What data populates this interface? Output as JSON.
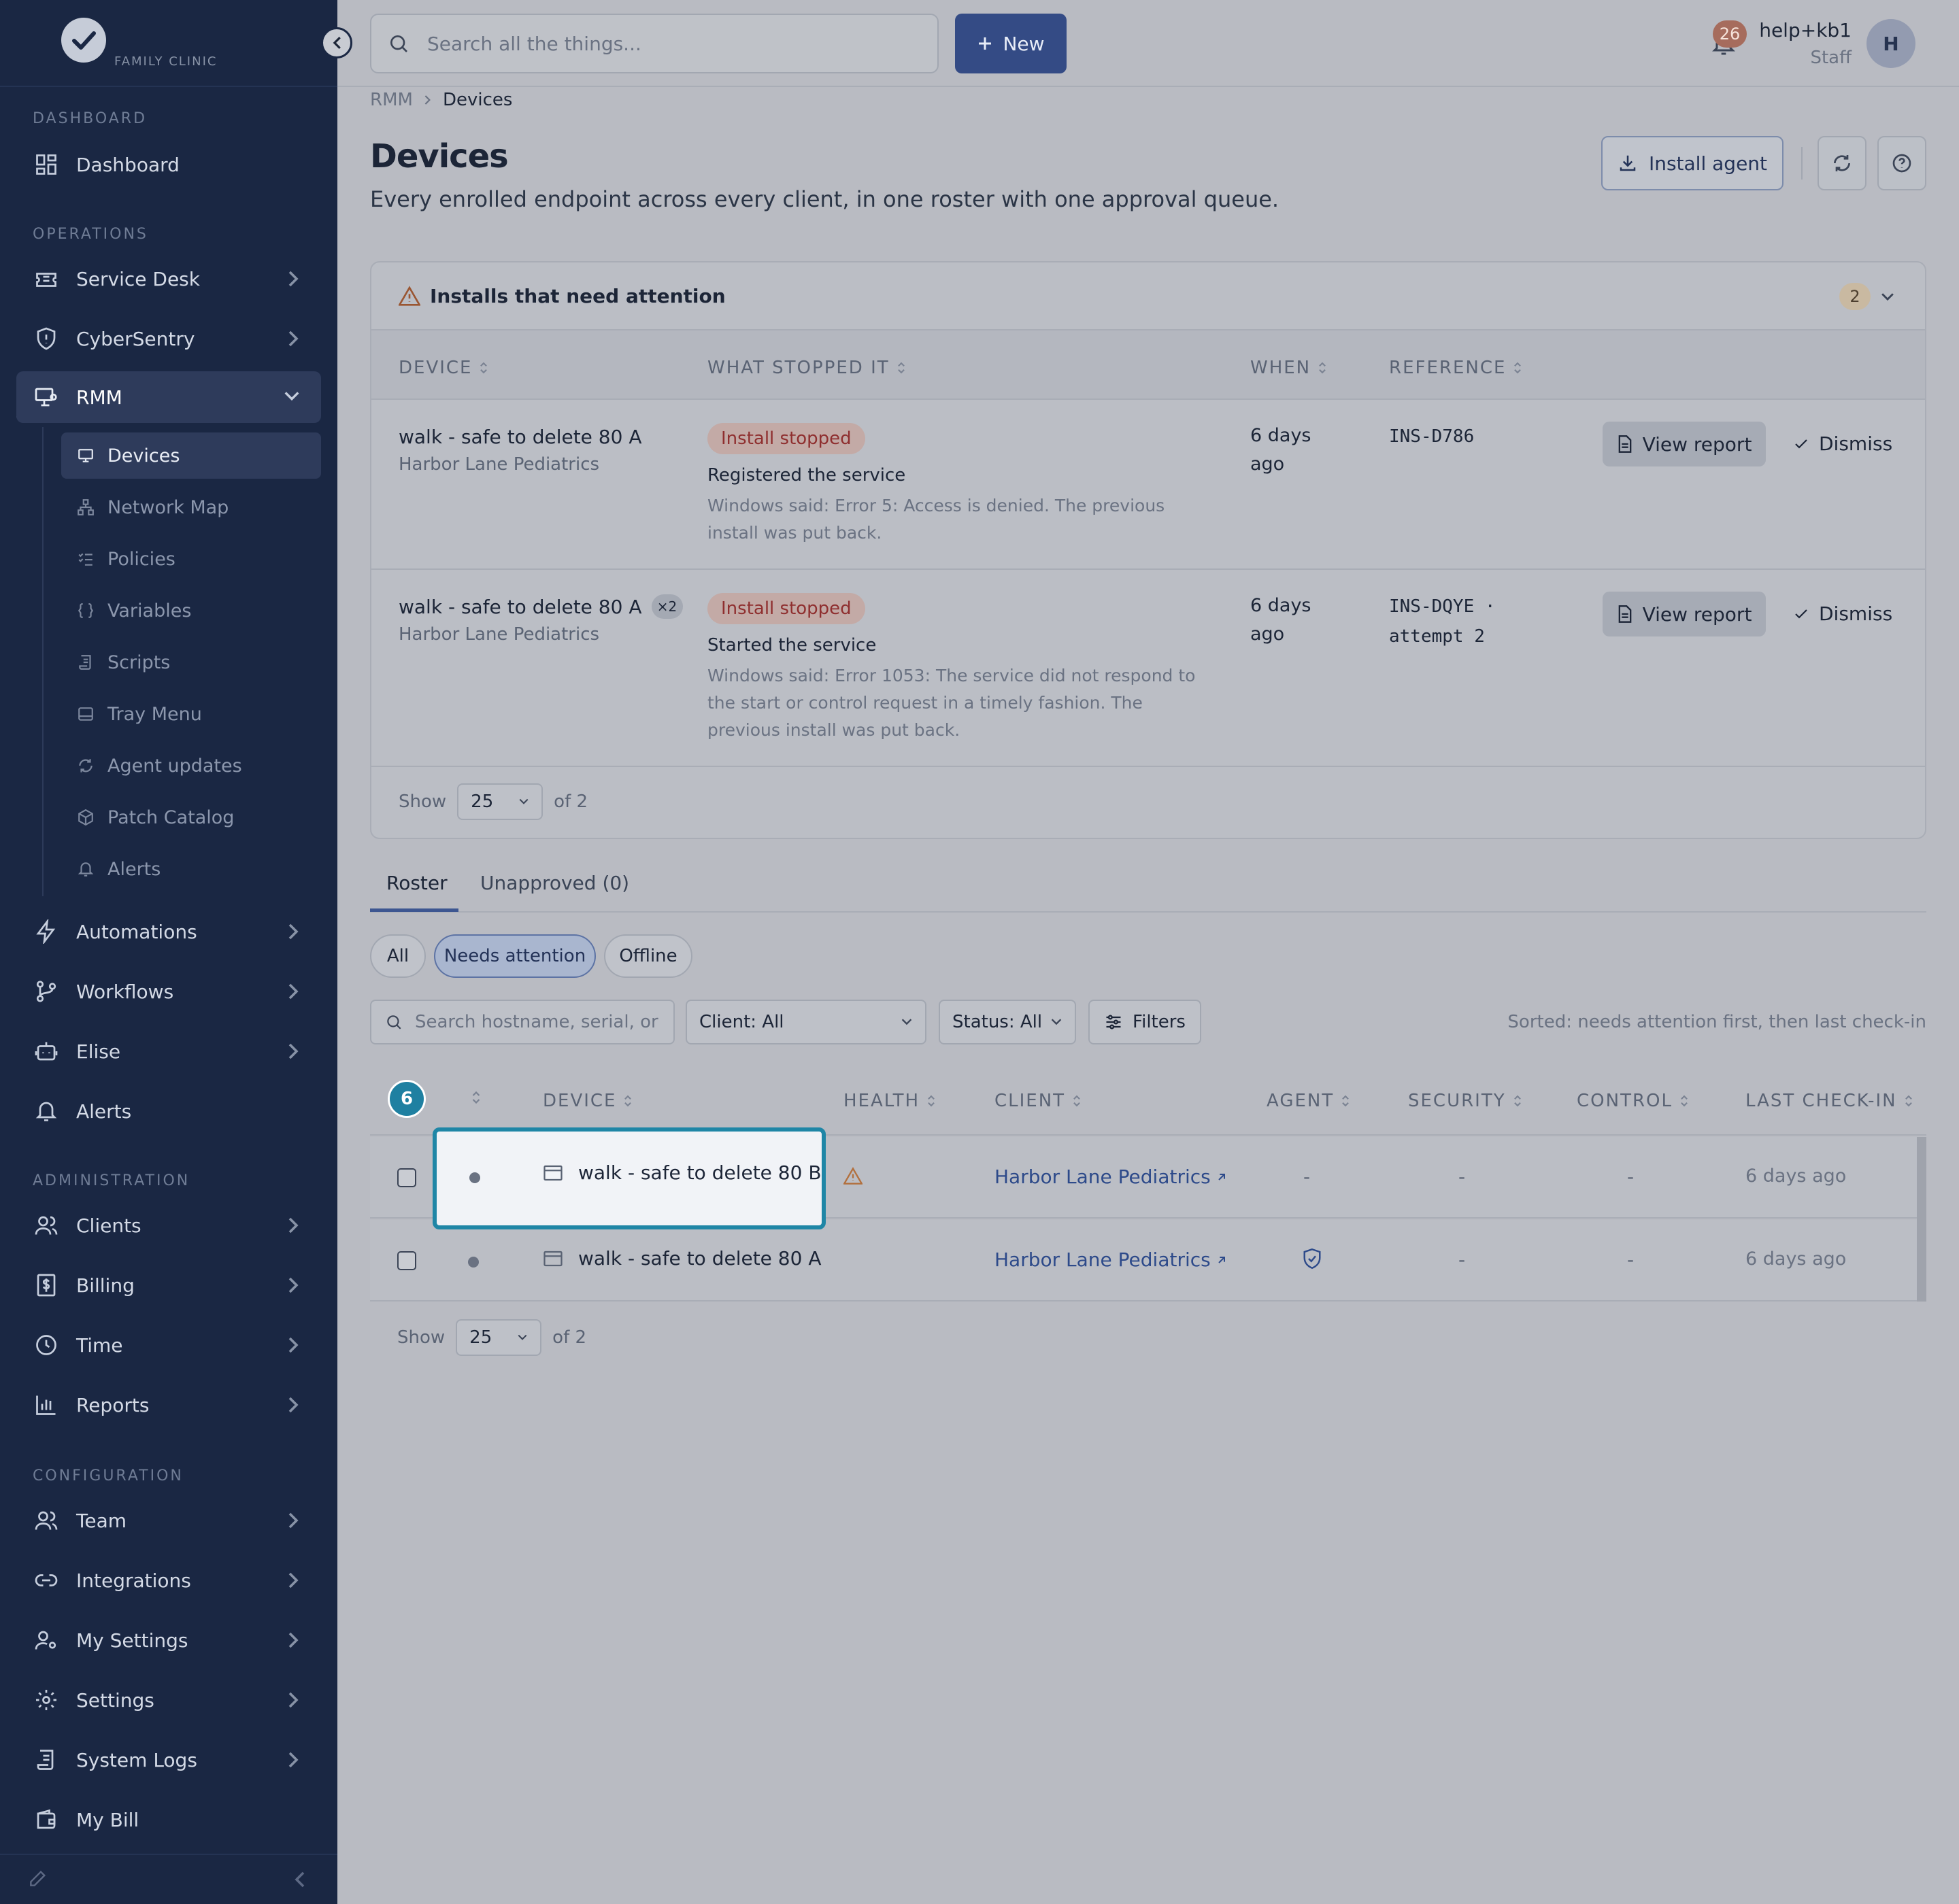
{
  "brand": {
    "tagline": "FAMILY CLINIC"
  },
  "sidebar": {
    "sections": {
      "dashboard": "DASHBOARD",
      "operations": "OPERATIONS",
      "administration": "ADMINISTRATION",
      "configuration": "CONFIGURATION"
    },
    "items": {
      "dashboard": "Dashboard",
      "service_desk": "Service Desk",
      "cybersentry": "CyberSentry",
      "rmm": "RMM",
      "automations": "Automations",
      "workflows": "Workflows",
      "elise": "Elise",
      "alerts": "Alerts",
      "clients": "Clients",
      "billing": "Billing",
      "time": "Time",
      "reports": "Reports",
      "team": "Team",
      "integrations": "Integrations",
      "my_settings": "My Settings",
      "settings": "Settings",
      "system_logs": "System Logs",
      "my_bill": "My Bill"
    },
    "rmm_sub": {
      "devices": "Devices",
      "network_map": "Network Map",
      "policies": "Policies",
      "variables": "Variables",
      "scripts": "Scripts",
      "tray_menu": "Tray Menu",
      "agent_updates": "Agent updates",
      "patch_catalog": "Patch Catalog",
      "alerts": "Alerts"
    }
  },
  "topbar": {
    "search_placeholder": "Search all the things...",
    "new_label": "New",
    "notification_count": "26",
    "user_name": "help+kb1",
    "user_role": "Staff",
    "avatar_initial": "H"
  },
  "breadcrumb": {
    "parent": "RMM",
    "current": "Devices"
  },
  "page": {
    "title": "Devices",
    "description": "Every enrolled endpoint across every client, in one roster with one approval queue.",
    "install_label": "Install agent"
  },
  "attention": {
    "title": "Installs that need attention",
    "count": "2",
    "columns": {
      "device": "DEVICE",
      "stopped": "WHAT STOPPED IT",
      "when": "WHEN",
      "reference": "REFERENCE"
    },
    "rows": [
      {
        "device": "walk - safe to delete 80 A",
        "badge": "",
        "client": "Harbor Lane Pediatrics",
        "status": "Install stopped",
        "stage": "Registered the service",
        "message": "Windows said: Error 5: Access is denied. The previous install was put back.",
        "when": "6 days ago",
        "reference": "INS-D786",
        "view_label": "View report",
        "dismiss_label": "Dismiss"
      },
      {
        "device": "walk - safe to delete 80 A",
        "badge": "×2",
        "client": "Harbor Lane Pediatrics",
        "status": "Install stopped",
        "stage": "Started the service",
        "message": "Windows said: Error 1053: The service did not respond to the start or control request in a timely fashion. The previous install was put back.",
        "when": "6 days ago",
        "reference": "INS-DQYE ·\nattempt 2",
        "view_label": "View report",
        "dismiss_label": "Dismiss"
      }
    ],
    "pager": {
      "show": "Show",
      "size": "25",
      "of": "of 2"
    }
  },
  "tabs": {
    "roster": "Roster",
    "unapproved": "Unapproved (0)"
  },
  "chips": {
    "all": "All",
    "needs_attention": "Needs attention",
    "offline": "Offline"
  },
  "filters": {
    "search_placeholder": "Search hostname, serial, or",
    "client": "Client: All",
    "status": "Status: All",
    "filters_label": "Filters",
    "sort_note": "Sorted: needs attention first, then last check-in"
  },
  "roster": {
    "step_number": "6",
    "columns": {
      "device": "DEVICE",
      "health": "HEALTH",
      "client": "CLIENT",
      "agent": "AGENT",
      "security": "SECURITY",
      "control": "CONTROL",
      "last_checkin": "LAST CHECK-IN"
    },
    "rows": [
      {
        "device": "walk - safe to delete 80 B",
        "client": "Harbor Lane Pediatrics",
        "agent": "-",
        "security": "-",
        "control": "-",
        "last_checkin": "6 days ago"
      },
      {
        "device": "walk - safe to delete 80 A",
        "client": "Harbor Lane Pediatrics",
        "agent": "",
        "security": "-",
        "control": "-",
        "last_checkin": "6 days ago"
      }
    ],
    "pager": {
      "show": "Show",
      "size": "25",
      "of": "of 2"
    }
  },
  "colors": {
    "sidebar": "#1a2743",
    "accent": "#344b85",
    "highlight": "#1f86a6",
    "danger": "#8f2f2f"
  }
}
